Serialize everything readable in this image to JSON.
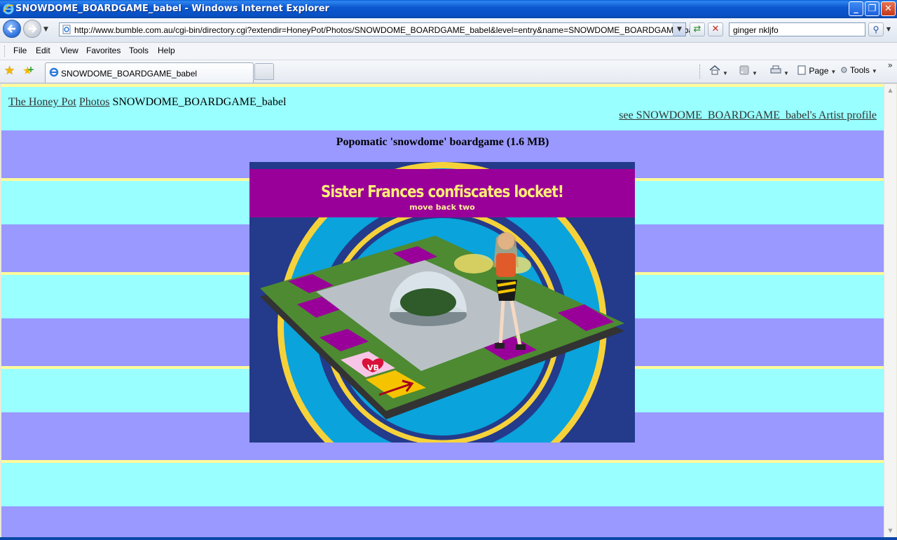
{
  "window": {
    "title": "SNOWDOME_BOARDGAME_babel - Windows Internet Explorer",
    "controls": {
      "minimize": "_",
      "restore": "❐",
      "close": "✕"
    }
  },
  "address_bar": {
    "url": "http://www.bumble.com.au/cgi-bin/directory.cgi?extendir=HoneyPot/Photos/SNOWDOME_BOARDGAME_babel&level=entry&name=SNOWDOME_BOARDGAME_babel",
    "search_value": "ginger nkljfo"
  },
  "menu": {
    "items": [
      "File",
      "Edit",
      "View",
      "Favorites",
      "Tools",
      "Help"
    ]
  },
  "tabs": {
    "active_label": "SNOWDOME_BOARDGAME_babel"
  },
  "command_bar": {
    "page_label": "Page",
    "tools_label": "Tools",
    "overflow": "»"
  },
  "content": {
    "breadcrumb": {
      "link1": "The Honey Pot",
      "link2": "Photos",
      "current": "SNOWDOME_BOARDGAME_babel"
    },
    "profile_link": "see SNOWDOME_BOARDGAME_babel's Artist profile",
    "caption": "Popomatic 'snowdome' boardgame (1.6 MB)",
    "image": {
      "headline": "Sister Frances confiscates locket!",
      "subline": "move back two",
      "badge": "VB"
    }
  },
  "colors": {
    "stripe_yellow": "#fffb99",
    "stripe_cyan": "#99ffff",
    "stripe_periwinkle": "#9999ff",
    "image_banner": "#990099",
    "image_background": "#243a8a"
  },
  "icons": [
    "ie-logo-icon",
    "back-arrow-icon",
    "forward-arrow-icon",
    "page-icon",
    "refresh-icon",
    "stop-icon",
    "search-icon",
    "favorites-star-icon",
    "add-favorites-icon",
    "home-icon",
    "feeds-icon",
    "print-icon",
    "page-menu-icon",
    "tools-gear-icon"
  ]
}
